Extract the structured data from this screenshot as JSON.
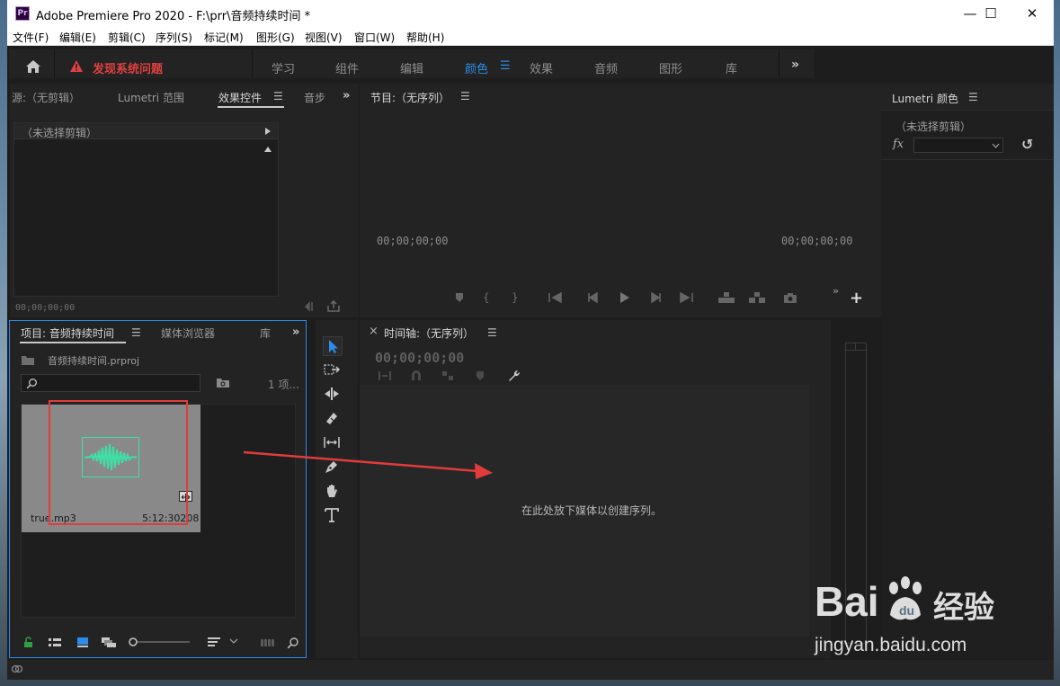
{
  "window": {
    "title": "Adobe Premiere Pro 2020 - F:\\prr\\音频持续时间 *",
    "app_icon_text": "Pr",
    "controls": {
      "minimize": "—",
      "maximize": "☐",
      "close": "✕"
    }
  },
  "menubar": {
    "items": [
      "文件(F)",
      "编辑(E)",
      "剪辑(C)",
      "序列(S)",
      "标记(M)",
      "图形(G)",
      "视图(V)",
      "窗口(W)",
      "帮助(H)"
    ]
  },
  "workspace": {
    "warning": "发现系统问题",
    "tabs": [
      "学习",
      "组件",
      "编辑",
      "颜色",
      "效果",
      "音频",
      "图形",
      "库"
    ],
    "active_tab": "颜色",
    "active_icon": "☰",
    "more": "»"
  },
  "source_panel": {
    "tabs": [
      "源:（无剪辑）",
      "Lumetri 范围",
      "效果控件",
      "音步"
    ],
    "active_tab": "效果控件",
    "burger": "☰",
    "more": "»",
    "no_clip": "（未选择剪辑）",
    "timecode": "00;00;00;00"
  },
  "program_panel": {
    "title": "节目:（无序列）",
    "burger": "☰",
    "timecode_left": "00;00;00;00",
    "timecode_right": "00;00;00;00",
    "controls": [
      "marker-icon",
      "in-point-icon",
      "out-point-icon",
      "go-to-in-icon",
      "step-back-icon",
      "play-icon",
      "step-forward-icon",
      "go-to-out-icon",
      "lift-icon",
      "extract-icon",
      "export-frame-icon"
    ],
    "add": "+",
    "more": "»"
  },
  "lumetri_panel": {
    "title": "Lumetri 颜色",
    "burger": "☰",
    "no_clip": "（未选择剪辑）",
    "fx": "fx",
    "reset": "↺"
  },
  "project_panel": {
    "tabs": [
      "项目: 音频持续时间",
      "媒体浏览器",
      "库"
    ],
    "active_tab": "项目: 音频持续时间",
    "burger": "☰",
    "more": "»",
    "project_file": "音频持续时间.prproj",
    "item_count": "1 项...",
    "clip": {
      "name": "true.mp3",
      "duration": "5:12:30208"
    }
  },
  "timeline_panel": {
    "close": "×",
    "title": "时间轴:（无序列）",
    "burger": "☰",
    "timecode": "00;00;00;00",
    "drop_hint": "在此处放下媒体以创建序列。"
  },
  "watermark": {
    "brand": "Bai",
    "brand_suffix": "经验",
    "url": "jingyan.baidu.com"
  },
  "colors": {
    "accent": "#2d8ceb",
    "warning": "#e04040",
    "waveform": "#3fe0a5",
    "annotation": "#e23b3b"
  }
}
